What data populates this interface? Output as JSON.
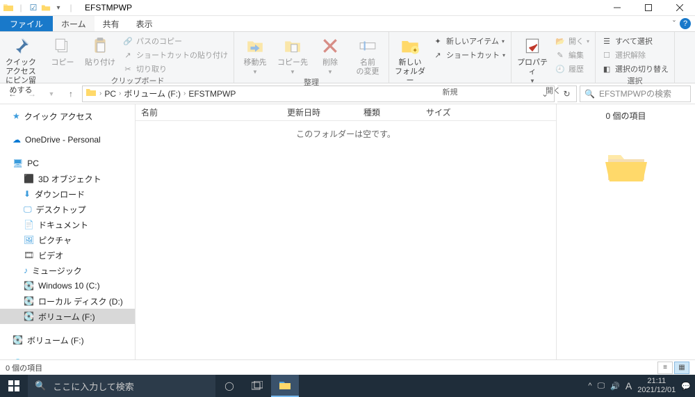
{
  "titlebar": {
    "title": "EFSTMPWP"
  },
  "tabs": {
    "file": "ファイル",
    "home": "ホーム",
    "share": "共有",
    "view": "表示"
  },
  "ribbon": {
    "quick_access": "クイック アクセス\nにピン留めする",
    "copy": "コピー",
    "paste": "貼り付け",
    "copy_path": "パスのコピー",
    "paste_shortcut": "ショートカットの貼り付け",
    "cut": "切り取り",
    "group_clip": "クリップボード",
    "move_to": "移動先",
    "copy_to": "コピー先",
    "delete": "削除",
    "rename": "名前\nの変更",
    "group_org": "整理",
    "new_folder": "新しい\nフォルダー",
    "new_item": "新しいアイテム",
    "shortcut": "ショートカット",
    "group_new": "新規",
    "properties": "プロパティ",
    "open": "開く",
    "edit": "編集",
    "history": "履歴",
    "group_open": "開く",
    "select_all": "すべて選択",
    "select_none": "選択解除",
    "select_invert": "選択の切り替え",
    "group_select": "選択"
  },
  "breadcrumb": {
    "pc": "PC",
    "vol": "ボリューム (F:)",
    "folder": "EFSTMPWP"
  },
  "search": {
    "placeholder": "EFSTMPWPの検索"
  },
  "columns": {
    "name": "名前",
    "date": "更新日時",
    "type": "種類",
    "size": "サイズ"
  },
  "content": {
    "empty": "このフォルダーは空です。"
  },
  "preview": {
    "count": "0 個の項目"
  },
  "sidebar": {
    "quick": "クイック アクセス",
    "onedrive": "OneDrive - Personal",
    "pc": "PC",
    "obj3d": "3D オブジェクト",
    "downloads": "ダウンロード",
    "desktop": "デスクトップ",
    "documents": "ドキュメント",
    "pictures": "ピクチャ",
    "videos": "ビデオ",
    "music": "ミュージック",
    "cdrive": "Windows 10 (C:)",
    "ddrive": "ローカル ディスク (D:)",
    "fdrive": "ボリューム (F:)",
    "fdrive2": "ボリューム (F:)",
    "network": "ネットワーク"
  },
  "status": {
    "items": "0 個の項目"
  },
  "taskbar": {
    "search": "ここに入力して検索",
    "time": "21:11",
    "date": "2021/12/01",
    "ime": "A"
  }
}
